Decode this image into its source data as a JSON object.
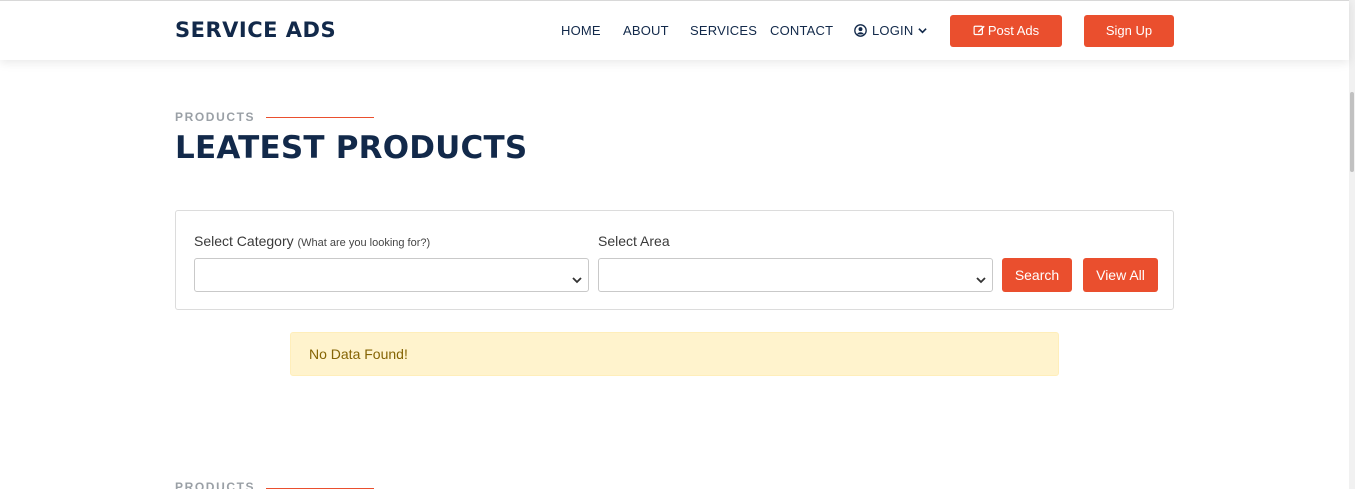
{
  "header": {
    "logo": "SERVICE ADS",
    "nav": [
      "HOME",
      "ABOUT",
      "SERVICES",
      "CONTACT"
    ],
    "login_label": "LOGIN",
    "post_ads_label": "Post Ads",
    "signup_label": "Sign Up"
  },
  "section": {
    "eyebrow": "PRODUCTS",
    "title": "LEATEST PRODUCTS"
  },
  "filter": {
    "category_label": "Select Category",
    "category_hint": "(What are you looking for?)",
    "category_value": "",
    "area_label": "Select Area",
    "area_value": "",
    "search_label": "Search",
    "view_all_label": "View All"
  },
  "alert": {
    "message": "No Data Found!"
  },
  "section2": {
    "eyebrow": "PRODUCTS"
  },
  "colors": {
    "accent": "#ea4f2e",
    "navy": "#12294a",
    "alert_bg": "#fff3cd",
    "alert_text": "#856404"
  },
  "icons": {
    "login": "user-circle-icon",
    "login_dropdown": "chevron-down-icon",
    "post_ads": "edit-icon",
    "select": "chevron-down-icon"
  }
}
